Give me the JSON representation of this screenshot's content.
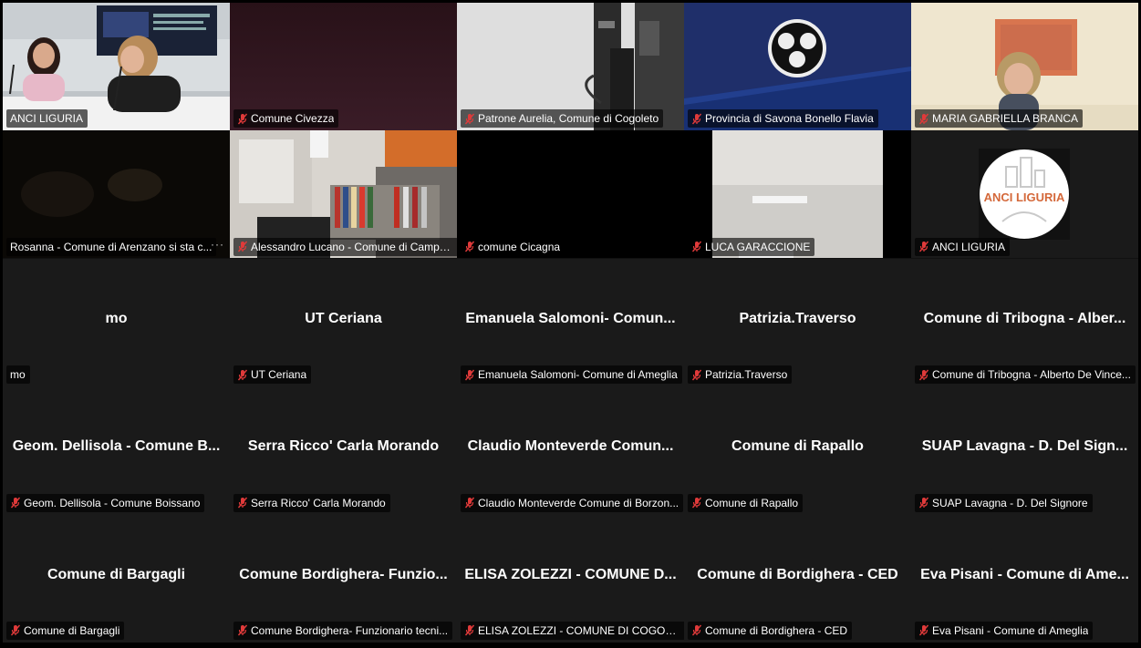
{
  "app": {
    "accent_active_border": "#c7d964",
    "muted_icon_color": "#e03a3a"
  },
  "tiles": [
    {
      "big_name": "",
      "label": "ANCI LIGURIA",
      "muted": false,
      "video": true,
      "active": true
    },
    {
      "big_name": "",
      "label": "Comune Civezza",
      "muted": true,
      "video": true
    },
    {
      "big_name": "",
      "label": "Patrone Aurelia, Comune di Cogoleto",
      "muted": true,
      "video": true
    },
    {
      "big_name": "",
      "label": "Provincia di Savona Bonello Flavia",
      "muted": true,
      "video": true
    },
    {
      "big_name": "",
      "label": "MARIA GABRIELLA BRANCA",
      "muted": true,
      "video": true
    },
    {
      "big_name": "",
      "label": "Rosanna - Comune di Arenzano si sta c...",
      "muted": false,
      "video": true,
      "more": "···"
    },
    {
      "big_name": "",
      "label": "Alessandro Lucano - Comune di Campo...",
      "muted": true,
      "video": true
    },
    {
      "big_name": "",
      "label": "comune Cicagna",
      "muted": true,
      "video": true
    },
    {
      "big_name": "",
      "label": "LUCA GARACCIONE",
      "muted": true,
      "video": true
    },
    {
      "big_name": "",
      "label": "ANCI LIGURIA",
      "muted": true,
      "video": true,
      "logo_text": "ANCI LIGURIA"
    },
    {
      "big_name": "mo",
      "label": "mo",
      "muted": false
    },
    {
      "big_name": "UT Ceriana",
      "label": "UT Ceriana",
      "muted": true
    },
    {
      "big_name": "Emanuela Salomoni- Comun...",
      "label": "Emanuela Salomoni- Comune di Ameglia",
      "muted": true
    },
    {
      "big_name": "Patrizia.Traverso",
      "label": "Patrizia.Traverso",
      "muted": true
    },
    {
      "big_name": "Comune di Tribogna - Alber...",
      "label": "Comune di Tribogna - Alberto De Vince...",
      "muted": true
    },
    {
      "big_name": "Geom. Dellisola - Comune B...",
      "label": "Geom. Dellisola - Comune Boissano",
      "muted": true
    },
    {
      "big_name": "Serra Ricco' Carla Morando",
      "label": "Serra Ricco' Carla Morando",
      "muted": true
    },
    {
      "big_name": "Claudio Monteverde Comun...",
      "label": "Claudio Monteverde Comune di Borzon...",
      "muted": true
    },
    {
      "big_name": "Comune di Rapallo",
      "label": "Comune di Rapallo",
      "muted": true
    },
    {
      "big_name": "SUAP Lavagna - D. Del Sign...",
      "label": "SUAP Lavagna - D. Del Signore",
      "muted": true
    },
    {
      "big_name": "Comune di Bargagli",
      "label": "Comune di Bargagli",
      "muted": true
    },
    {
      "big_name": "Comune Bordighera- Funzio...",
      "label": "Comune Bordighera- Funzionario tecni...",
      "muted": true
    },
    {
      "big_name": "ELISA ZOLEZZI - COMUNE D...",
      "label": "ELISA ZOLEZZI - COMUNE DI COGORNO",
      "muted": true
    },
    {
      "big_name": "Comune di Bordighera - CED",
      "label": "Comune di Bordighera - CED",
      "muted": true
    },
    {
      "big_name": "Eva Pisani - Comune di Ame...",
      "label": "Eva Pisani - Comune di Ameglia",
      "muted": true
    }
  ]
}
